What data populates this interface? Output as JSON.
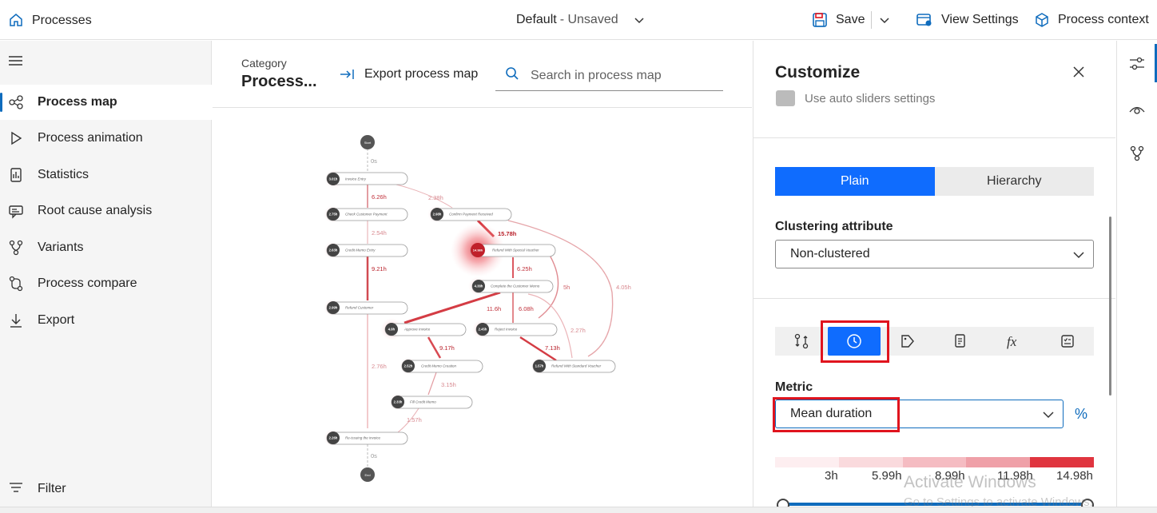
{
  "topbar": {
    "title": "Processes",
    "doc_name": "Default",
    "doc_state": "- Unsaved",
    "save_label": "Save",
    "view_settings_label": "View Settings",
    "process_context_label": "Process context"
  },
  "nav": {
    "items": [
      {
        "label": "Process map",
        "icon": "process-map-icon",
        "active": true
      },
      {
        "label": "Process animation",
        "icon": "play-icon"
      },
      {
        "label": "Statistics",
        "icon": "statistics-icon"
      },
      {
        "label": "Root cause analysis",
        "icon": "root-cause-icon"
      },
      {
        "label": "Variants",
        "icon": "variants-icon"
      },
      {
        "label": "Process compare",
        "icon": "compare-icon"
      },
      {
        "label": "Export",
        "icon": "export-icon"
      }
    ],
    "filter_label": "Filter"
  },
  "map_header": {
    "category_label": "Category",
    "category_value": "Process...",
    "export_label": "Export process map",
    "search_placeholder": "Search in process map"
  },
  "process_map": {
    "nodes": [
      {
        "id": "start",
        "label": "Start"
      },
      {
        "id": "n1",
        "badge": "3.01h",
        "label": "Invoice Entry"
      },
      {
        "id": "n2",
        "badge": "2.75h",
        "label": "Check Customer Payment"
      },
      {
        "id": "n3",
        "badge": "2.98h",
        "label": "Confirm Payment Received"
      },
      {
        "id": "n4",
        "badge": "2.63h",
        "label": "Credit Memo Entry"
      },
      {
        "id": "n5",
        "badge": "14.98h",
        "label": "Refund With Special Voucher"
      },
      {
        "id": "n6",
        "badge": "4.38h",
        "label": "Complete the Customer Memo"
      },
      {
        "id": "n7",
        "badge": "2.99h",
        "label": "Refund Customer"
      },
      {
        "id": "n8",
        "badge": "4.9h",
        "label": "Approve Invoice"
      },
      {
        "id": "n9",
        "badge": "2.45h",
        "label": "Reject Invoice"
      },
      {
        "id": "n10",
        "badge": "2.52h",
        "label": "Credit Memo Creation"
      },
      {
        "id": "n11",
        "badge": "1.57h",
        "label": "Refund With Standard Voucher"
      },
      {
        "id": "n12",
        "badge": "2.33h",
        "label": "Fill Credit Memo"
      },
      {
        "id": "n13",
        "badge": "2.26h",
        "label": "Re-issuing the invoice"
      },
      {
        "id": "end",
        "label": "End"
      }
    ],
    "edge_labels": [
      "0s",
      "6.26h",
      "2.38h",
      "2.54h",
      "15.78h",
      "9.21h",
      "6.25h",
      "5h",
      "4.05h",
      "11.6h",
      "6.08h",
      "2.27h",
      "9.17h",
      "7.13h",
      "2.76h",
      "3.15h",
      "1.57h",
      "0s"
    ]
  },
  "customize": {
    "title": "Customize",
    "auto_sliders_label": "Use auto sliders settings",
    "view_mode": {
      "plain": "Plain",
      "hierarchy": "Hierarchy",
      "selected": "Plain"
    },
    "clustering_label": "Clustering attribute",
    "clustering_value": "Non-clustered",
    "metric_tabs": [
      "frequency-icon",
      "clock-icon",
      "tag-icon",
      "document-icon",
      "function-icon",
      "checklist-icon"
    ],
    "metric_tab_selected": "clock-icon",
    "metric_label": "Metric",
    "metric_value": "Mean duration",
    "percent_label": "%",
    "legend_labels": [
      "3h",
      "5.99h",
      "8.99h",
      "11.98h",
      "14.98h"
    ],
    "legend_colors": [
      "#fdeef0",
      "#fadadd",
      "#f5bcc2",
      "#efa0a8",
      "#e0353f"
    ]
  },
  "watermark": {
    "line1": "Activate Windows",
    "line2": "Go to Settings to activate Windows."
  }
}
